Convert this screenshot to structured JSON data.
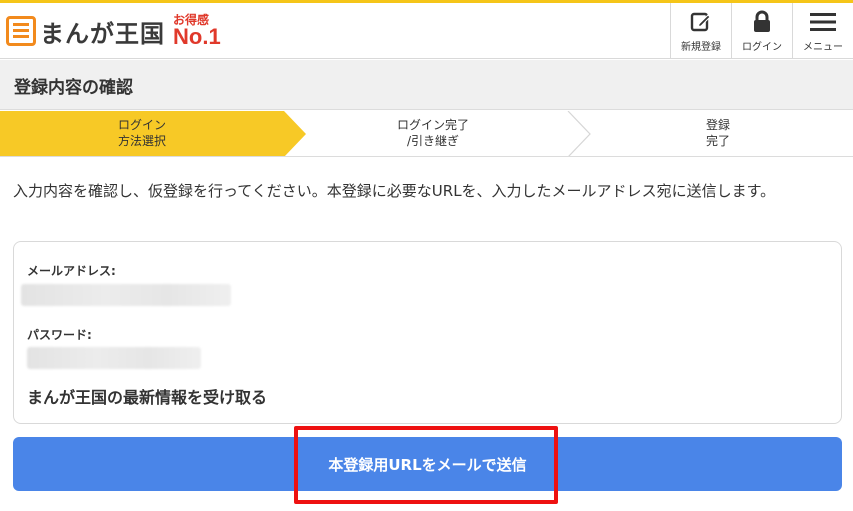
{
  "header": {
    "logo_text": "まんが王国",
    "badge_top": "お得感",
    "badge_main": "No.1",
    "nav": [
      {
        "label": "新規登録",
        "icon": "edit-icon"
      },
      {
        "label": "ログイン",
        "icon": "lock-icon"
      },
      {
        "label": "メニュー",
        "icon": "hamburger-icon"
      }
    ]
  },
  "page": {
    "title": "登録内容の確認"
  },
  "steps": [
    {
      "line1": "ログイン",
      "line2": "方法選択",
      "active": true
    },
    {
      "line1": "ログイン完了",
      "line2": "/引き継ぎ",
      "active": false
    },
    {
      "line1": "登録",
      "line2": "完了",
      "active": false
    }
  ],
  "intro_text": "入力内容を確認し、仮登録を行ってください。本登録に必要なURLを、入力したメールアドレス宛に送信します。",
  "form": {
    "email_label": "メールアドレス:",
    "password_label": "パスワード:",
    "newsletter_text": "まんが王国の最新情報を受け取る"
  },
  "submit_label": "本登録用URLをメールで送信",
  "colors": {
    "accent": "#f5c518",
    "button": "#4a85e8",
    "brand_red": "#e0392b",
    "highlight": "#ee1111"
  }
}
